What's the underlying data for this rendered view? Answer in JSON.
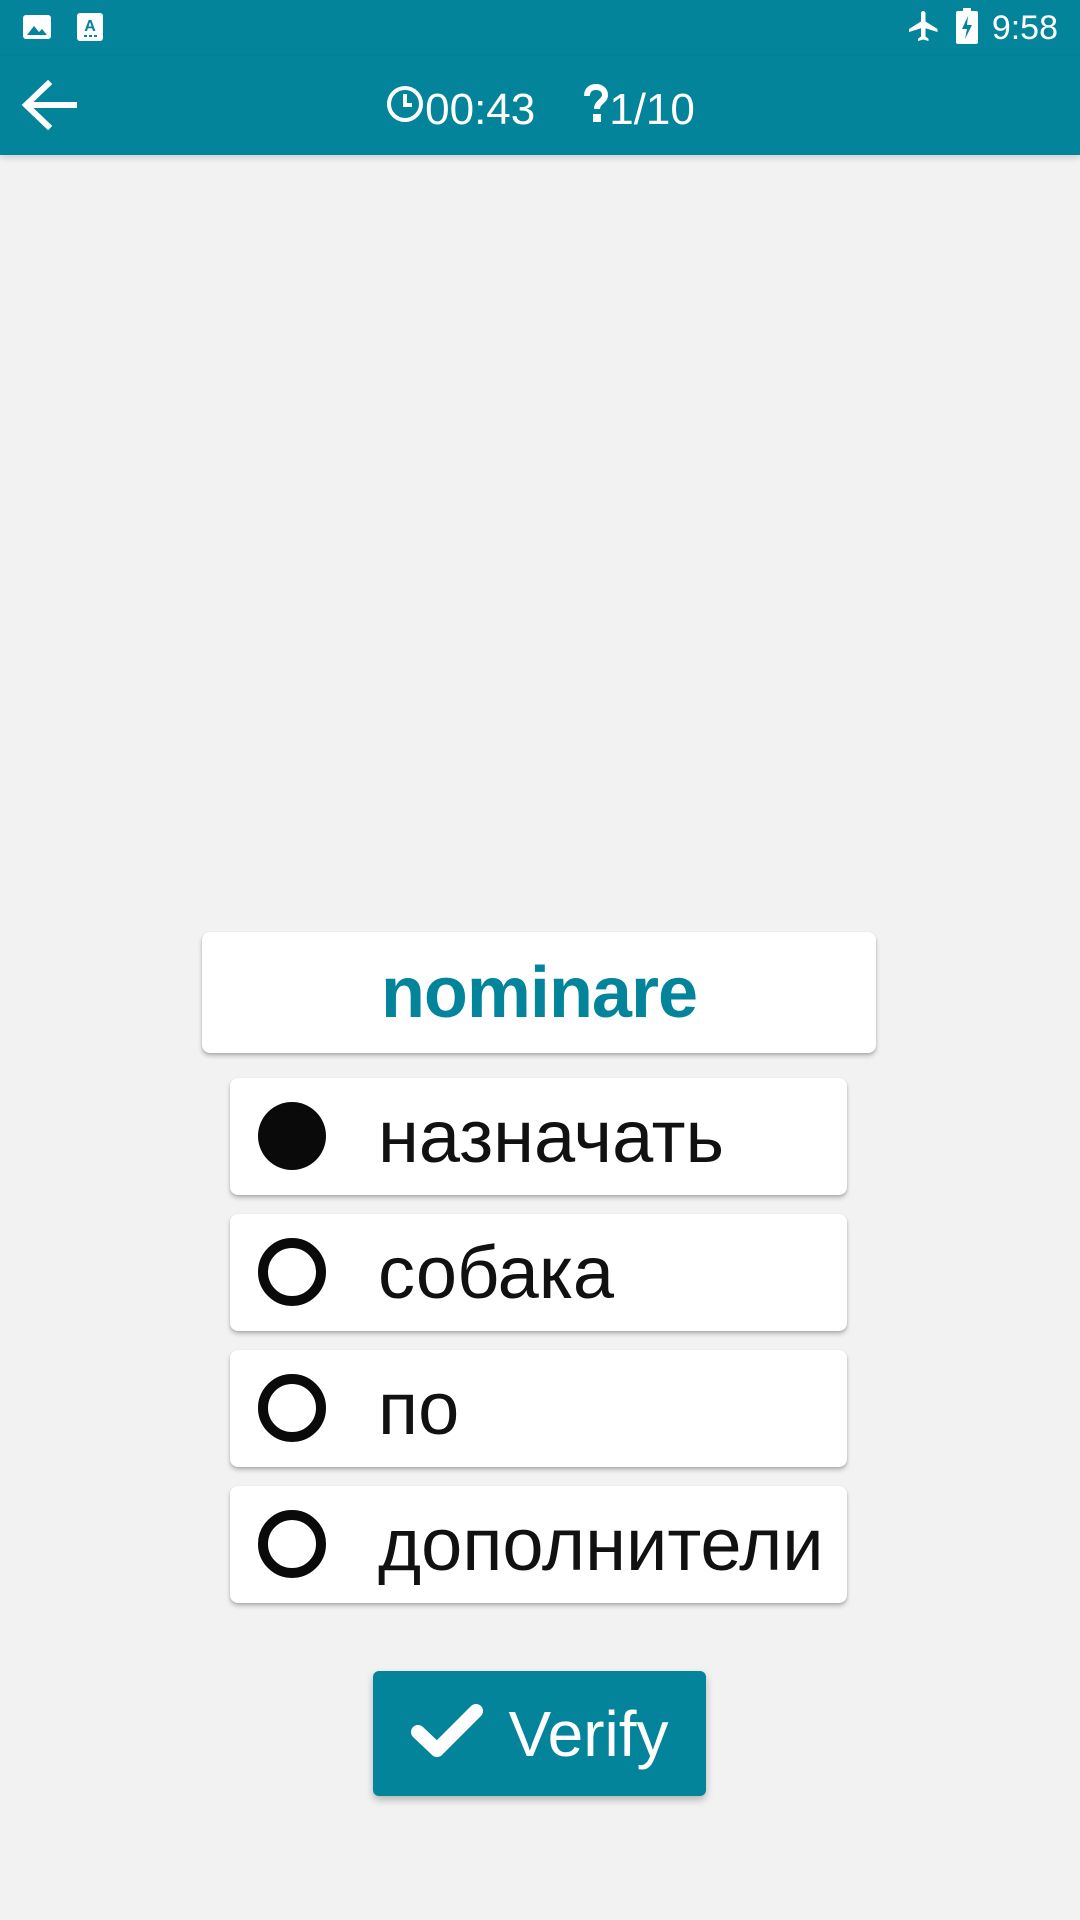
{
  "colors": {
    "accent": "#03849a",
    "background": "#f2f2f2",
    "card": "#ffffff",
    "text": "#111111"
  },
  "status_bar": {
    "left_icons": [
      "image-icon",
      "text-recognition-icon"
    ],
    "right_icons": [
      "airplane-mode-icon",
      "battery-charging-icon"
    ],
    "time": "9:58"
  },
  "app_bar": {
    "back_icon": "arrow-left-icon",
    "timer_icon": "clock-icon",
    "timer": "00:43",
    "progress_icon": "question-icon",
    "progress": "1/10"
  },
  "quiz": {
    "word": "nominare",
    "options": [
      {
        "label": "назначать",
        "selected": true
      },
      {
        "label": "собака",
        "selected": false
      },
      {
        "label": "по",
        "selected": false
      },
      {
        "label": "дополнители",
        "selected": false
      }
    ]
  },
  "verify_button": {
    "icon": "check-icon",
    "label": "Verify"
  }
}
